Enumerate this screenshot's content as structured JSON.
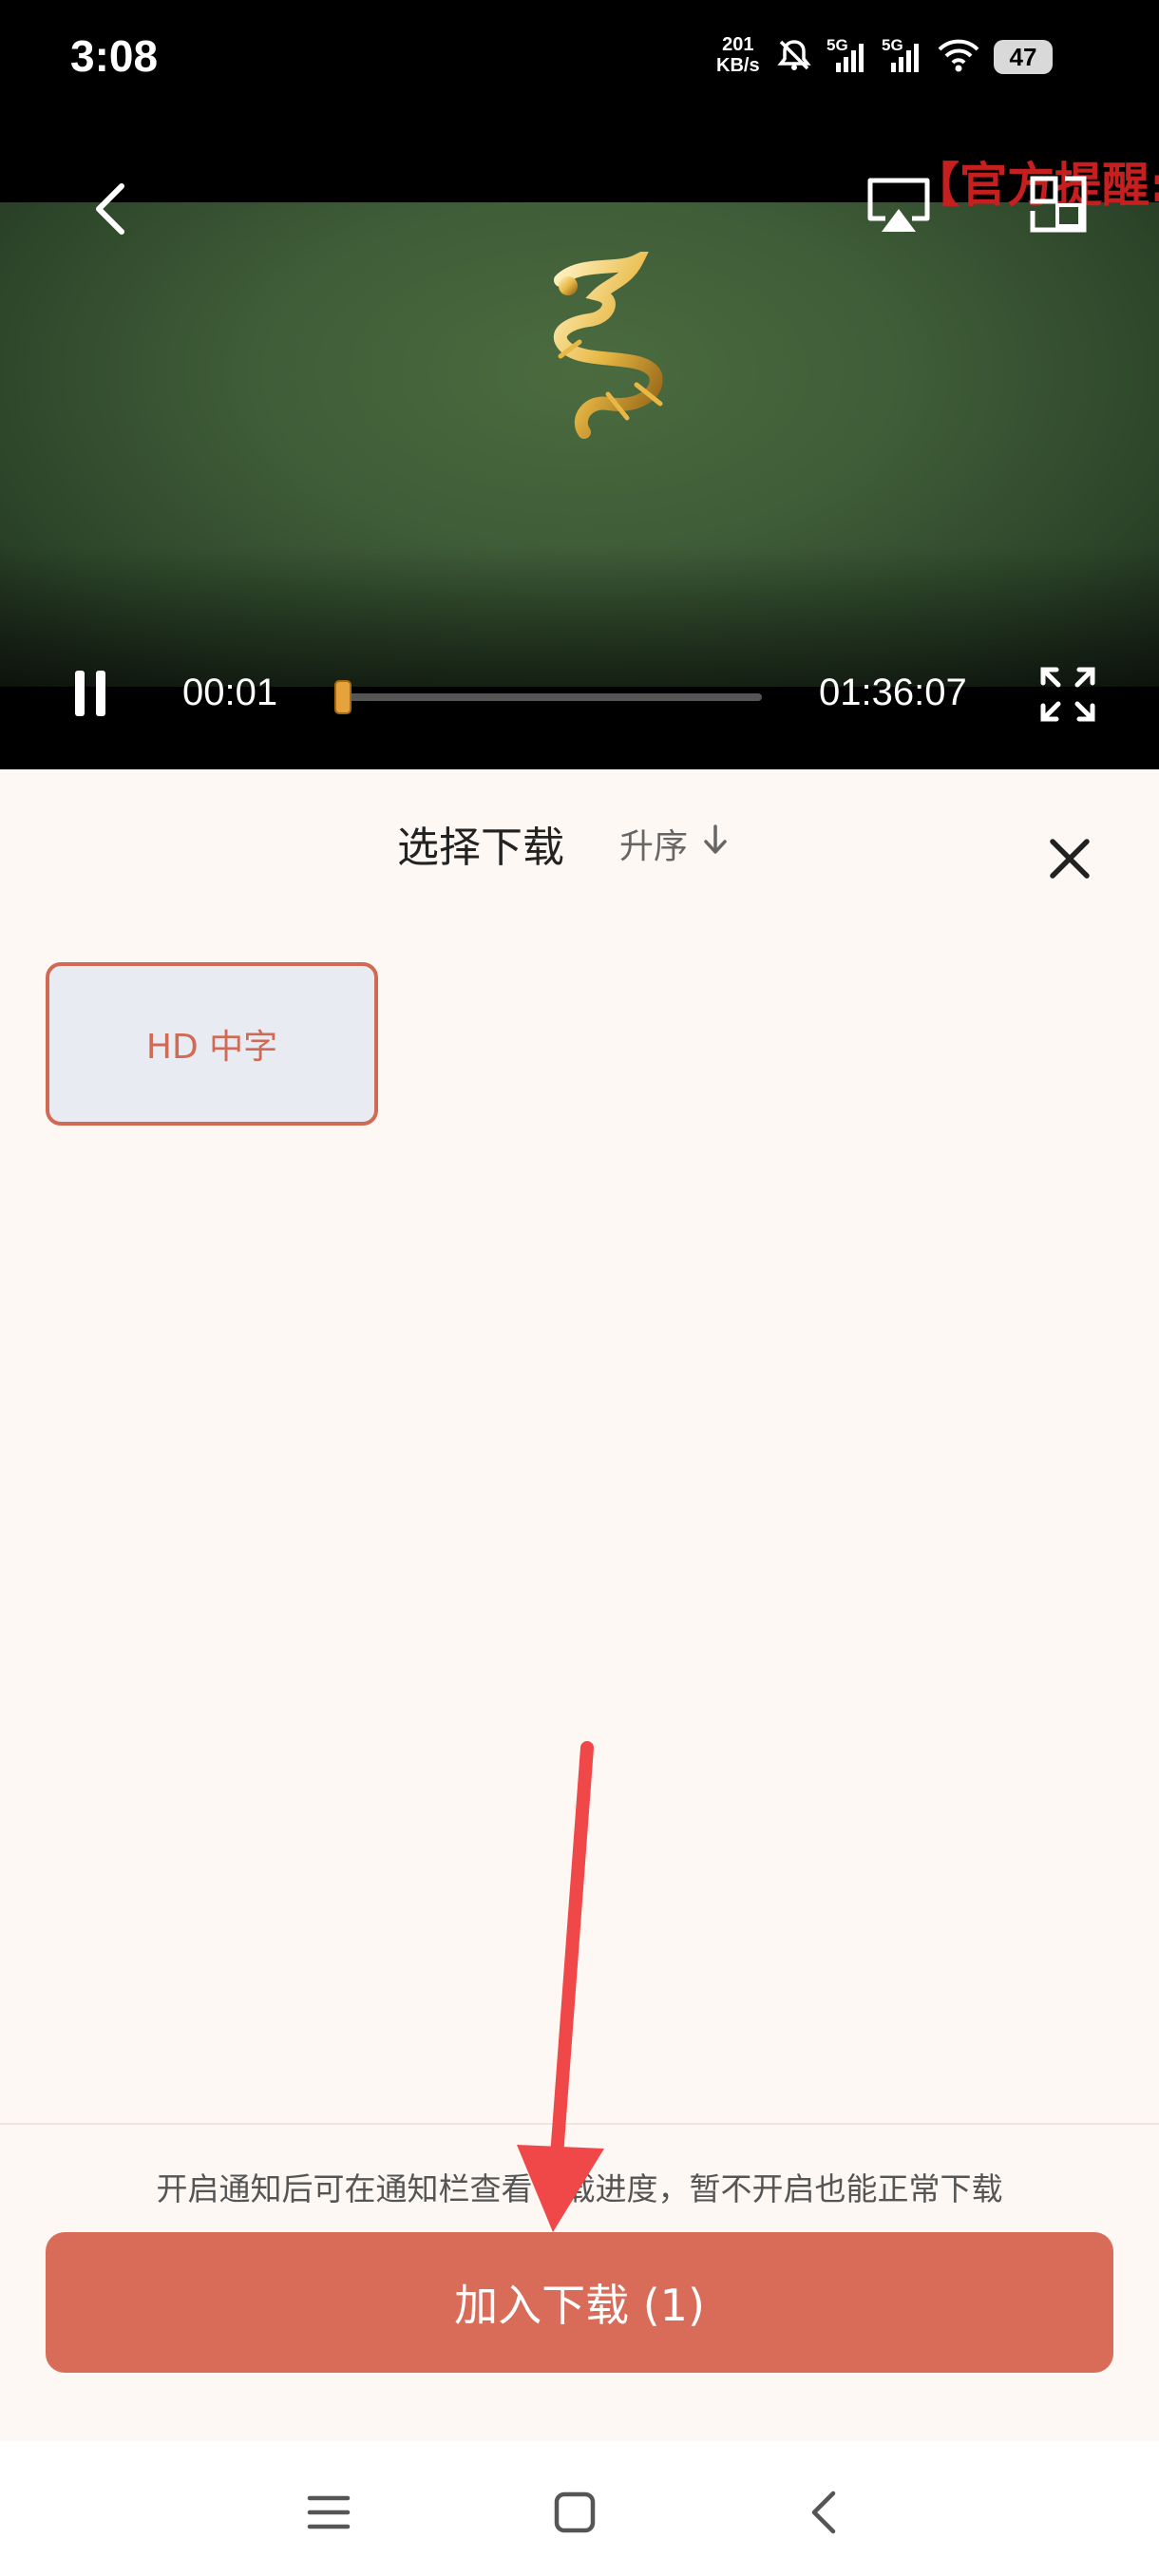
{
  "status_bar": {
    "time": "3:08",
    "net_speed_value": "201",
    "net_speed_unit": "KB/s",
    "signal1_label": "5G",
    "signal2_label": "5G",
    "battery": "47"
  },
  "video": {
    "notice_text": "【官方提醒:",
    "current_time": "00:01",
    "total_time": "01:36:07",
    "progress": 0.01
  },
  "sheet": {
    "title": "选择下载",
    "sort_label": "升序",
    "episodes": [
      {
        "label": "HD 中字",
        "selected": true
      }
    ],
    "hint": "开启通知后可在通知栏查看下载进度，暂不开启也能正常下载",
    "download_button": "加入下载 (1)"
  },
  "colors": {
    "accent": "#d86c59",
    "chip_border": "#d06a55",
    "chip_bg": "#e8ebf2",
    "notice_red": "#c51f1f",
    "progress": "#e6a23c",
    "arrow": "#f04848"
  },
  "icons": [
    "back-icon",
    "cast-icon",
    "pip-icon",
    "pause-icon",
    "fullscreen-icon",
    "sort-down-icon",
    "close-icon",
    "menu-icon",
    "home-icon",
    "nav-back-icon",
    "wifi-icon",
    "mute-icon",
    "signal-icon"
  ]
}
